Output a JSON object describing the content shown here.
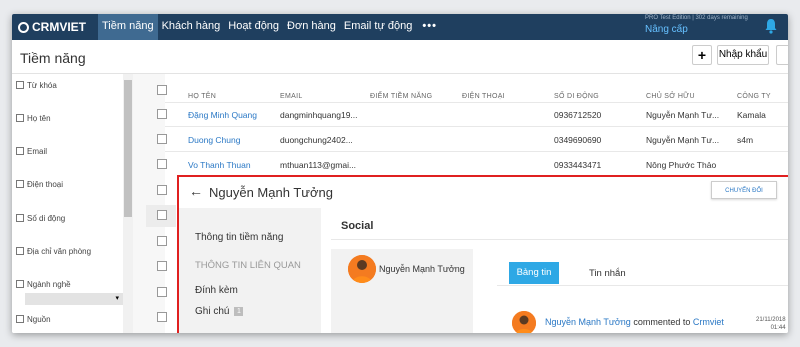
{
  "app": {
    "logo": "CRMVIET",
    "edition": "PRO Test Edition | 302 days remaining",
    "upgrade": "Nâng cấp"
  },
  "nav": {
    "items": [
      {
        "label": "Tiềm năng",
        "active": true
      },
      {
        "label": "Khách hàng"
      },
      {
        "label": "Hoạt động"
      },
      {
        "label": "Đơn hàng"
      },
      {
        "label": "Email tự động"
      }
    ],
    "more": "•••"
  },
  "header": {
    "title": "Tiềm năng",
    "plus": "+",
    "import_label": "Nhập khẩu"
  },
  "filters": {
    "items": [
      "Từ khóa",
      "Họ tên",
      "Email",
      "Điện thoại",
      "Số di động",
      "Địa chỉ văn phòng",
      "Ngành nghề",
      "Nguồn"
    ],
    "select_arrow": "▾"
  },
  "table": {
    "columns": [
      "HỌ TÊN",
      "EMAIL",
      "ĐIỂM TIỀM NĂNG",
      "ĐIỆN THOẠI",
      "SỐ DI ĐỘNG",
      "CHỦ SỞ HỮU",
      "CÔNG TY"
    ],
    "rows": [
      {
        "name": "Đặng Minh Quang",
        "email": "dangminhquang19...",
        "mobile": "0936712520",
        "owner": "Nguyễn Mạnh Tư...",
        "company": "Kamala"
      },
      {
        "name": "Duong Chung",
        "email": "duongchung2402...",
        "mobile": "0349690690",
        "owner": "Nguyễn Mạnh Tư...",
        "company": "s4m"
      },
      {
        "name": "Vo Thanh Thuan",
        "email": "mthuan113@gmai...",
        "mobile": "0933443471",
        "owner": "Nông Phước Thảo",
        "company": ""
      }
    ]
  },
  "detail": {
    "back": "←",
    "title": "Nguyễn Mạnh Tưởng",
    "convert_label": "CHUYỂN ĐỔI",
    "sidebar": {
      "info": "Thông tin tiềm năng",
      "related": "THÔNG TIN LIÊN QUAN",
      "attachments": "Đính kèm",
      "notes": "Ghi chú",
      "notes_count": "1"
    },
    "social_title": "Social",
    "contact_name": "Nguyễn Mạnh Tưởng",
    "tabs": {
      "news": "Bảng tin",
      "messages": "Tin nhắn"
    },
    "feed": {
      "author": "Nguyễn Mạnh Tưởng",
      "action": " commented to ",
      "target": "Crmviet",
      "date": "21/11/2018",
      "time": "01:44"
    }
  },
  "colors": {
    "nav_bg": "#1f3f5f",
    "nav_active": "#3f6a91",
    "link": "#2a78c5",
    "accent_tab": "#2ea8e5",
    "highlight_border": "#e02020",
    "avatar": "#f47b20"
  },
  "icons": [
    "crmviet-logo-icon",
    "bell-icon",
    "back-arrow-icon",
    "checkbox-icon",
    "avatar-icon"
  ]
}
